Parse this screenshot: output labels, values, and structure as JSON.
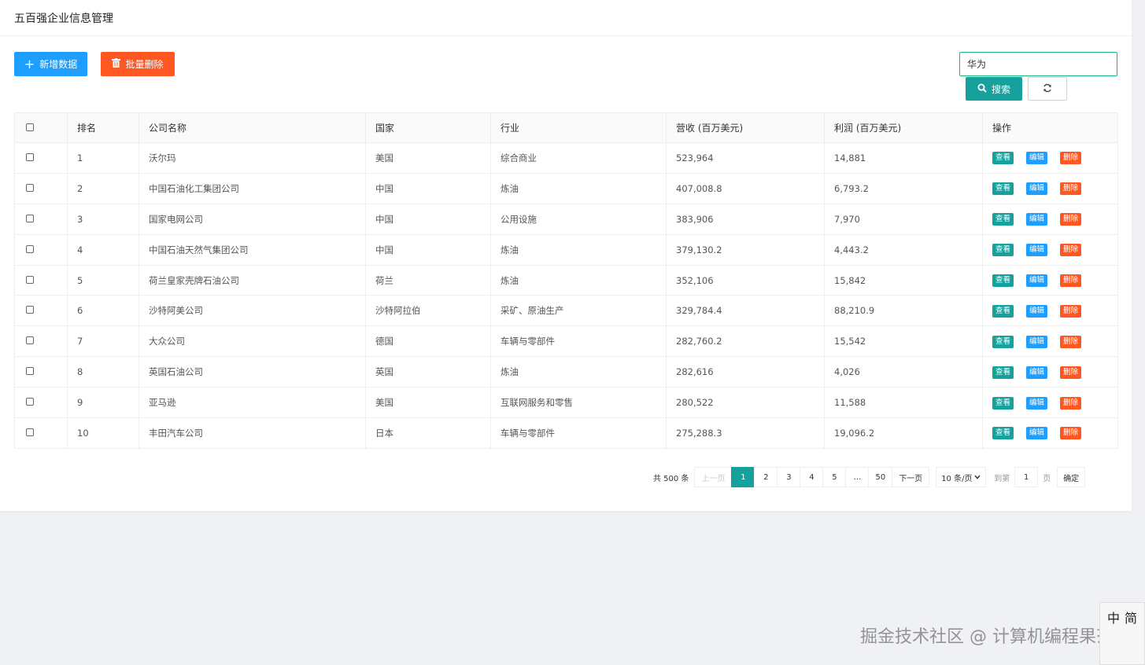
{
  "page": {
    "title": "五百强企业信息管理"
  },
  "toolbar": {
    "add_label": "新增数据",
    "batch_delete_label": "批量删除",
    "search_value": "华为",
    "search_label": "搜索"
  },
  "table": {
    "headers": [
      "排名",
      "公司名称",
      "国家",
      "行业",
      "营收 (百万美元)",
      "利润 (百万美元)",
      "操作"
    ],
    "action_labels": {
      "view": "查看",
      "edit": "编辑",
      "delete": "删除"
    },
    "rows": [
      [
        "1",
        "沃尔玛",
        "美国",
        "综合商业",
        "523,964",
        "14,881"
      ],
      [
        "2",
        "中国石油化工集团公司",
        "中国",
        "炼油",
        "407,008.8",
        "6,793.2"
      ],
      [
        "3",
        "国家电网公司",
        "中国",
        "公用设施",
        "383,906",
        "7,970"
      ],
      [
        "4",
        "中国石油天然气集团公司",
        "中国",
        "炼油",
        "379,130.2",
        "4,443.2"
      ],
      [
        "5",
        "荷兰皇家壳牌石油公司",
        "荷兰",
        "炼油",
        "352,106",
        "15,842"
      ],
      [
        "6",
        "沙特阿美公司",
        "沙特阿拉伯",
        "采矿、原油生产",
        "329,784.4",
        "88,210.9"
      ],
      [
        "7",
        "大众公司",
        "德国",
        "车辆与零部件",
        "282,760.2",
        "15,542"
      ],
      [
        "8",
        "英国石油公司",
        "英国",
        "炼油",
        "282,616",
        "4,026"
      ],
      [
        "9",
        "亚马逊",
        "美国",
        "互联网服务和零售",
        "280,522",
        "11,588"
      ],
      [
        "10",
        "丰田汽车公司",
        "日本",
        "车辆与零部件",
        "275,288.3",
        "19,096.2"
      ]
    ]
  },
  "pagination": {
    "total": "共 500 条",
    "prev": "上一页",
    "pages": [
      "1",
      "2",
      "3",
      "4",
      "5",
      "…",
      "50"
    ],
    "active_page": "1",
    "next": "下一页",
    "limit": "10 条/页",
    "goto_label": "到第",
    "goto_value": "1",
    "page_suffix": "页",
    "confirm": "确定"
  },
  "watermark": "掘金技术社区 @ 计算机编程果茶熊",
  "ime": {
    "mode": "中",
    "variant": "简"
  },
  "colors": {
    "primary": "#16a19c",
    "blue": "#1e9fff",
    "danger": "#ff5722"
  }
}
